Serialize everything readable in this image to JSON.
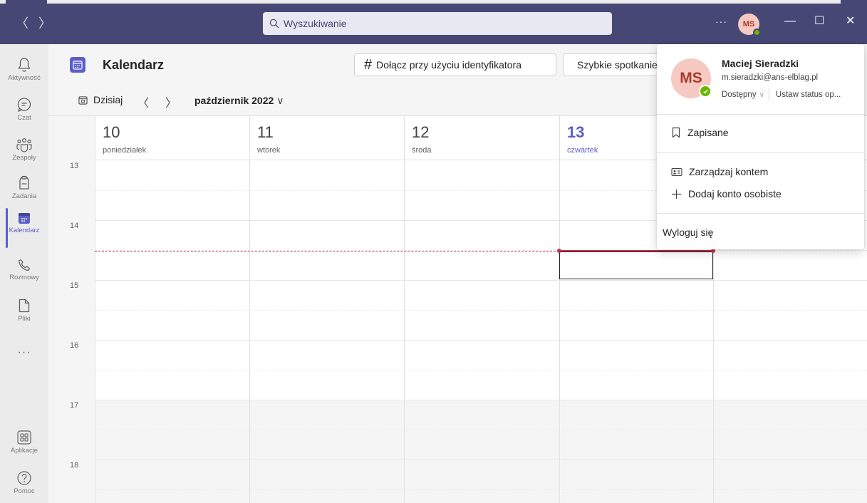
{
  "titlebar": {
    "search_placeholder": "Wyszukiwanie",
    "more_label": "···",
    "avatar_initials": "MS",
    "minimize": "—",
    "maximize": "☐",
    "close": "✕"
  },
  "rail": {
    "items": [
      {
        "label": "Aktywność",
        "icon": "bell-icon"
      },
      {
        "label": "Czat",
        "icon": "chat-icon"
      },
      {
        "label": "Zespoły",
        "icon": "teams-icon"
      },
      {
        "label": "Zadania",
        "icon": "tasks-icon"
      },
      {
        "label": "Kalendarz",
        "icon": "calendar-icon",
        "active": true
      },
      {
        "label": "Rozmowy",
        "icon": "phone-icon"
      },
      {
        "label": "Pliki",
        "icon": "file-icon"
      },
      {
        "label": "Aplikacje",
        "icon": "apps-icon"
      },
      {
        "label": "Pomoc",
        "icon": "help-icon"
      }
    ],
    "more_label": "···"
  },
  "header": {
    "title": "Kalendarz",
    "join_button": "Dołącz przy użyciu identyfikatora",
    "join_icon": "#",
    "meet_button": "Szybkie spotkanie"
  },
  "toolbar": {
    "today_label": "Dzisiaj",
    "prev": "〈",
    "next": "〉",
    "month": "październik 2022",
    "month_chevron": "∨"
  },
  "calendar": {
    "days": [
      {
        "num": "10",
        "name": "poniedziałek"
      },
      {
        "num": "11",
        "name": "wtorek"
      },
      {
        "num": "12",
        "name": "środa"
      },
      {
        "num": "13",
        "name": "czwartek",
        "today": true
      }
    ],
    "hours": [
      "13",
      "14",
      "15",
      "16",
      "17",
      "18"
    ]
  },
  "profile": {
    "initials": "MS",
    "name": "Maciej Sieradzki",
    "email": "m.sieradzki@ans-elblag.pl",
    "status": "Dostępny",
    "status_chevron": "∨",
    "set_status": "Ustaw status op...",
    "saved": "Zapisane",
    "manage_account": "Zarządzaj kontem",
    "add_personal": "Dodaj konto osobiste",
    "sign_out": "Wyloguj się"
  },
  "colors": {
    "titlebar": "#464775",
    "accent": "#5b5fc7",
    "now_line": "#c4314b",
    "presence": "#6bb700"
  }
}
